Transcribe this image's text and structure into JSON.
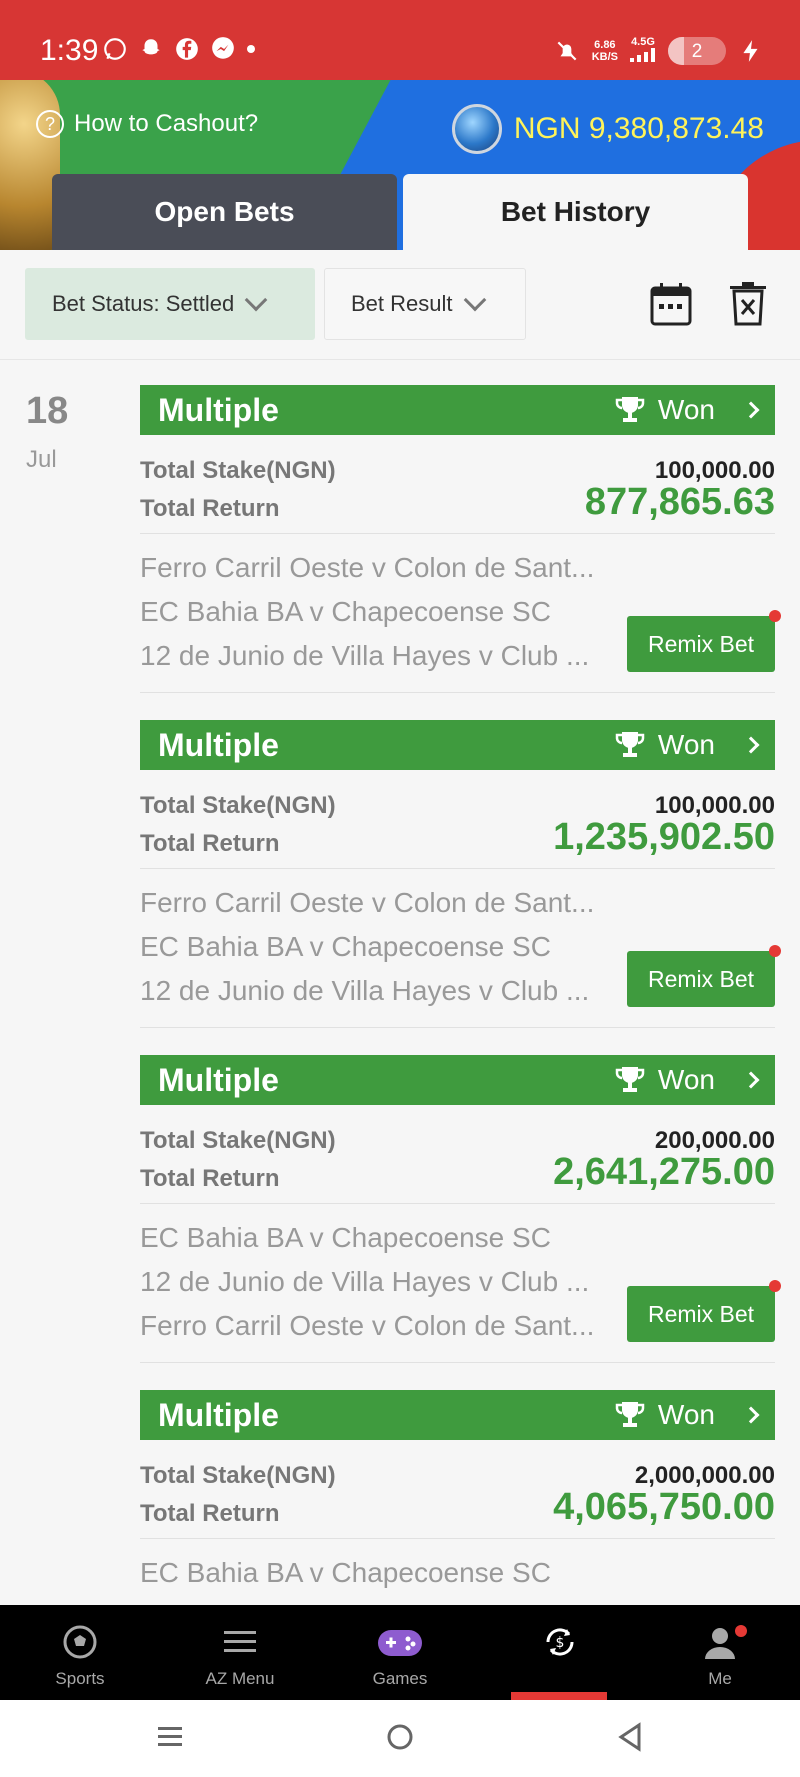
{
  "status_bar": {
    "time": "1:39",
    "net_speed_top": "6.86",
    "net_speed_bottom": "KB/S",
    "network": "4.5G",
    "battery": "2"
  },
  "header": {
    "help_text": "How to Cashout?",
    "balance": "NGN 9,380,873.48"
  },
  "tabs": [
    {
      "label": "Open Bets",
      "active": false
    },
    {
      "label": "Bet History",
      "active": true
    }
  ],
  "filters": {
    "status": "Bet Status: Settled",
    "result": "Bet Result"
  },
  "date": {
    "day": "18",
    "month": "Jul"
  },
  "labels": {
    "stake": "Total Stake(NGN)",
    "return": "Total Return",
    "remix": "Remix Bet"
  },
  "bets": [
    {
      "type": "Multiple",
      "status": "Won",
      "stake": "100,000.00",
      "return": "877,865.63",
      "matches": [
        "Ferro Carril Oeste v Colon de Sant...",
        "EC Bahia BA v Chapecoense SC",
        "12 de Junio de Villa Hayes v Club ..."
      ]
    },
    {
      "type": "Multiple",
      "status": "Won",
      "stake": "100,000.00",
      "return": "1,235,902.50",
      "matches": [
        "Ferro Carril Oeste v Colon de Sant...",
        "EC Bahia BA v Chapecoense SC",
        "12 de Junio de Villa Hayes v Club ..."
      ]
    },
    {
      "type": "Multiple",
      "status": "Won",
      "stake": "200,000.00",
      "return": "2,641,275.00",
      "matches": [
        "EC Bahia BA v Chapecoense SC",
        "12 de Junio de Villa Hayes v Club ...",
        "Ferro Carril Oeste v Colon de Sant..."
      ]
    },
    {
      "type": "Multiple",
      "status": "Won",
      "stake": "2,000,000.00",
      "return": "4,065,750.00",
      "matches": [
        "EC Bahia BA v Chapecoense SC"
      ]
    }
  ],
  "bottom_nav": [
    {
      "label": "Sports",
      "icon": "soccer-ball-icon"
    },
    {
      "label": "AZ Menu",
      "icon": "menu-icon"
    },
    {
      "label": "Games",
      "icon": "gamepad-icon"
    },
    {
      "label": "",
      "icon": "cashout-icon",
      "active": true
    },
    {
      "label": "Me",
      "icon": "user-icon"
    }
  ],
  "colors": {
    "brand_red": "#d73634",
    "won_green": "#3f9b3e",
    "balance_yellow": "#fff35a"
  }
}
